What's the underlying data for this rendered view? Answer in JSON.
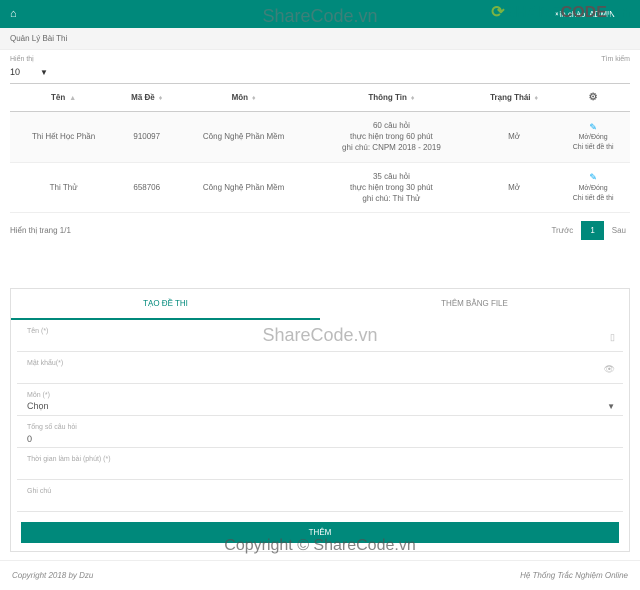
{
  "watermark": "ShareCode.vn",
  "watermark_copy": "Copyright © ShareCode.vn",
  "topbar": {
    "welcome": "Xin chào: ADMIN"
  },
  "page_title": "Quản Lý Bài Thi",
  "controls": {
    "show_label": "Hiển thị",
    "show_value": "10",
    "search_label": "Tìm kiếm"
  },
  "table": {
    "headers": {
      "name": "Tên",
      "code": "Mã Đề",
      "subject": "Môn",
      "info": "Thông Tin",
      "status": "Trạng Thái"
    },
    "rows": [
      {
        "name": "Thi Hết Học Phần",
        "code": "910097",
        "subject": "Công Nghệ Phần Mềm",
        "info_l1": "60 câu hỏi",
        "info_l2": "thực hiện trong 60 phút",
        "info_l3": "ghi chú: CNPM 2018 - 2019",
        "status": "Mở",
        "act1": "Mở/Đóng",
        "act2": "Chi tiết đề thi"
      },
      {
        "name": "Thi Thử",
        "code": "658706",
        "subject": "Công Nghệ Phần Mềm",
        "info_l1": "35 câu hỏi",
        "info_l2": "thực hiện trong 30 phút",
        "info_l3": "ghi chú: Thi Thử",
        "status": "Mở",
        "act1": "Mở/Đóng",
        "act2": "Chi tiết đề thi"
      }
    ],
    "footer_text": "Hiển thị trang 1/1",
    "prev": "Trước",
    "page": "1",
    "next": "Sau"
  },
  "form": {
    "tab_create": "TẠO ĐỀ THI",
    "tab_file": "THÊM BẰNG FILE",
    "name_label": "Tên (*)",
    "pass_label": "Mật khẩu(*)",
    "subject_label": "Môn (*)",
    "subject_value": "Chọn",
    "total_label": "Tổng số câu hỏi",
    "total_value": "0",
    "time_label": "Thời gian làm bài (phút) (*)",
    "note_label": "Ghi chú",
    "submit": "THÊM"
  },
  "footer": {
    "left": "Copyright 2018 by Dzu",
    "right": "Hệ Thống Trắc Nghiệm Online"
  }
}
